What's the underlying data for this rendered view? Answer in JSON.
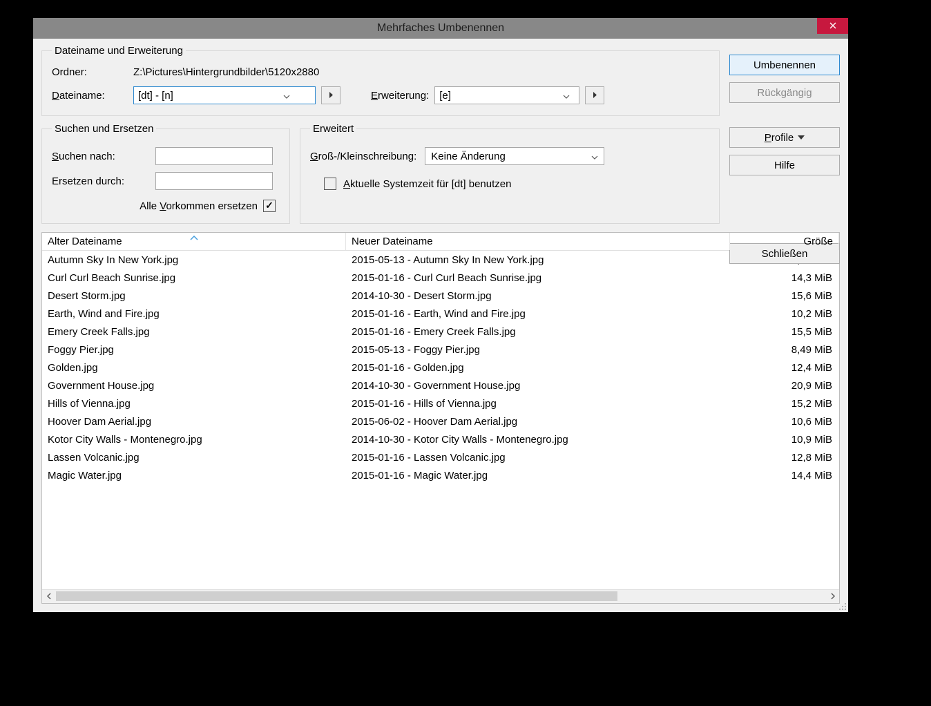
{
  "window": {
    "title": "Mehrfaches Umbenennen"
  },
  "group_filename": {
    "legend": "Dateiname und Erweiterung",
    "folder_label": "Ordner:",
    "folder_path": "Z:\\Pictures\\Hintergrundbilder\\5120x2880",
    "filename_label_pre": "D",
    "filename_label_post": "ateiname:",
    "filename_value": "[dt] - [n]",
    "extension_label_pre": "E",
    "extension_label_post": "rweiterung:",
    "extension_value": "[e]"
  },
  "group_search": {
    "legend": "Suchen und Ersetzen",
    "search_label_pre": "S",
    "search_label_post": "uchen nach:",
    "replace_label": "Ersetzen durch:",
    "all_label_pre": "Alle ",
    "all_label_ul": "V",
    "all_label_post": "orkommen ersetzen",
    "all_checked": true
  },
  "group_adv": {
    "legend": "Erweitert",
    "case_label_pre": "G",
    "case_label_post": "roß-/Kleinschreibung:",
    "case_value": "Keine Änderung",
    "systime_label_pre": "A",
    "systime_label_post": "ktuelle Systemzeit für [dt] benutzen",
    "systime_checked": false
  },
  "buttons": {
    "rename": "Umbenennen",
    "undo": "Rückgängig",
    "profile_pre": "P",
    "profile_post": "rofile",
    "help": "Hilfe",
    "close": "Schließen"
  },
  "list": {
    "col_old": "Alter Dateiname",
    "col_new": "Neuer Dateiname",
    "col_size": "Größe",
    "rows": [
      {
        "old": "Autumn Sky In New York.jpg",
        "new": "2015-05-13 - Autumn Sky In New York.jpg",
        "size": "8,15 MiB"
      },
      {
        "old": "Curl Curl Beach Sunrise.jpg",
        "new": "2015-01-16 - Curl Curl Beach Sunrise.jpg",
        "size": "14,3 MiB"
      },
      {
        "old": "Desert Storm.jpg",
        "new": "2014-10-30 - Desert Storm.jpg",
        "size": "15,6 MiB"
      },
      {
        "old": "Earth, Wind and Fire.jpg",
        "new": "2015-01-16 - Earth, Wind and Fire.jpg",
        "size": "10,2 MiB"
      },
      {
        "old": "Emery Creek Falls.jpg",
        "new": "2015-01-16 - Emery Creek Falls.jpg",
        "size": "15,5 MiB"
      },
      {
        "old": "Foggy Pier.jpg",
        "new": "2015-05-13 - Foggy Pier.jpg",
        "size": "8,49 MiB"
      },
      {
        "old": "Golden.jpg",
        "new": "2015-01-16 - Golden.jpg",
        "size": "12,4 MiB"
      },
      {
        "old": "Government House.jpg",
        "new": "2014-10-30 - Government House.jpg",
        "size": "20,9 MiB"
      },
      {
        "old": "Hills of Vienna.jpg",
        "new": "2015-01-16 - Hills of Vienna.jpg",
        "size": "15,2 MiB"
      },
      {
        "old": "Hoover Dam Aerial.jpg",
        "new": "2015-06-02 - Hoover Dam Aerial.jpg",
        "size": "10,6 MiB"
      },
      {
        "old": "Kotor City Walls - Montenegro.jpg",
        "new": "2014-10-30 - Kotor City Walls - Montenegro.jpg",
        "size": "10,9 MiB"
      },
      {
        "old": "Lassen Volcanic.jpg",
        "new": "2015-01-16 - Lassen Volcanic.jpg",
        "size": "12,8 MiB"
      },
      {
        "old": "Magic Water.jpg",
        "new": "2015-01-16 - Magic Water.jpg",
        "size": "14,4 MiB"
      }
    ]
  }
}
